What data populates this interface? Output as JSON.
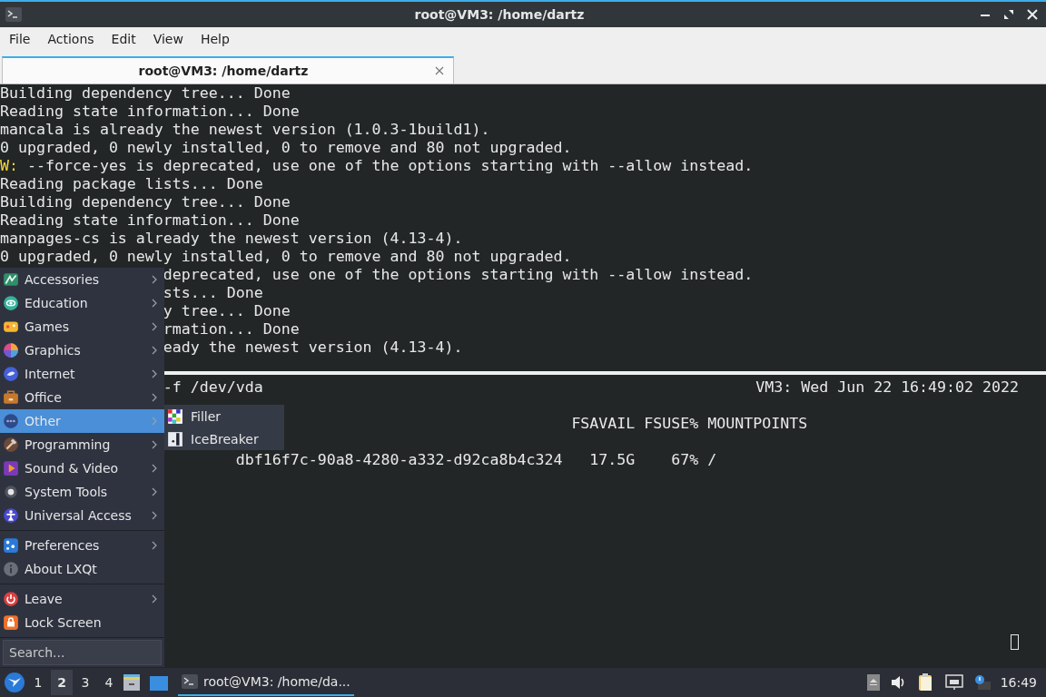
{
  "window": {
    "title": "root@VM3: /home/dartz"
  },
  "menubar": [
    "File",
    "Actions",
    "Edit",
    "View",
    "Help"
  ],
  "tabs": [
    {
      "label": "root@VM3: /home/dartz",
      "selected": true
    }
  ],
  "terminal_top": [
    {
      "kind": "plain",
      "text": "Building dependency tree... Done"
    },
    {
      "kind": "plain",
      "text": "Reading state information... Done"
    },
    {
      "kind": "plain",
      "text": "mancala is already the newest version (1.0.3-1build1)."
    },
    {
      "kind": "plain",
      "text": "0 upgraded, 0 newly installed, 0 to remove and 80 not upgraded."
    },
    {
      "kind": "warning",
      "label": "W:",
      "text": "--force-yes is deprecated, use one of the options starting with --allow instead."
    },
    {
      "kind": "plain",
      "text": "Reading package lists... Done"
    },
    {
      "kind": "plain",
      "text": "Building dependency tree... Done"
    },
    {
      "kind": "plain",
      "text": "Reading state information... Done"
    },
    {
      "kind": "plain",
      "text": "manpages-cs is already the newest version (4.13-4)."
    },
    {
      "kind": "plain",
      "text": "0 upgraded, 0 newly installed, 0 to remove and 80 not upgraded."
    },
    {
      "kind": "covered",
      "text": "deprecated, use one of the options starting with --allow instead."
    },
    {
      "kind": "covered",
      "text": "sts... Done"
    },
    {
      "kind": "covered",
      "text": "y tree... Done"
    },
    {
      "kind": "covered",
      "text": "rmation... Done"
    },
    {
      "kind": "covered",
      "text": "eady the newest version (4.13-4)."
    }
  ],
  "terminal_bottom": {
    "header_left": "-f /dev/vda",
    "header_right": "VM3: Wed Jun 22 16:49:02 2022",
    "lines": [
      "FSAVAIL FSUSE% MOUNTPOINTS",
      "dbf16f7c-90a8-4280-a332-d92ca8b4c324   17.5G    67% /"
    ]
  },
  "start_menu": {
    "sections": [
      [
        {
          "label": "Accessories",
          "submenu": true,
          "selected": false
        },
        {
          "label": "Education",
          "submenu": true,
          "selected": false
        },
        {
          "label": "Games",
          "submenu": true,
          "selected": false
        },
        {
          "label": "Graphics",
          "submenu": true,
          "selected": false
        },
        {
          "label": "Internet",
          "submenu": true,
          "selected": false
        },
        {
          "label": "Office",
          "submenu": true,
          "selected": false
        },
        {
          "label": "Other",
          "submenu": true,
          "selected": true
        },
        {
          "label": "Programming",
          "submenu": true,
          "selected": false
        },
        {
          "label": "Sound & Video",
          "submenu": true,
          "selected": false
        },
        {
          "label": "System Tools",
          "submenu": true,
          "selected": false
        },
        {
          "label": "Universal Access",
          "submenu": true,
          "selected": false
        }
      ],
      [
        {
          "label": "Preferences",
          "submenu": true,
          "selected": false
        },
        {
          "label": "About LXQt",
          "submenu": false,
          "selected": false
        }
      ],
      [
        {
          "label": "Leave",
          "submenu": true,
          "selected": false
        },
        {
          "label": "Lock Screen",
          "submenu": false,
          "selected": false
        }
      ]
    ],
    "search": {
      "placeholder": "Search..."
    },
    "submenu": [
      {
        "label": "Filler"
      },
      {
        "label": "IceBreaker"
      }
    ]
  },
  "taskbar": {
    "desktops": [
      {
        "label": "1",
        "selected": false
      },
      {
        "label": "2",
        "selected": true
      },
      {
        "label": "3",
        "selected": false
      },
      {
        "label": "4",
        "selected": false
      }
    ],
    "tasks": [
      {
        "label": "root@VM3: /home/da...",
        "selected": true
      }
    ],
    "clock": "16:49"
  }
}
